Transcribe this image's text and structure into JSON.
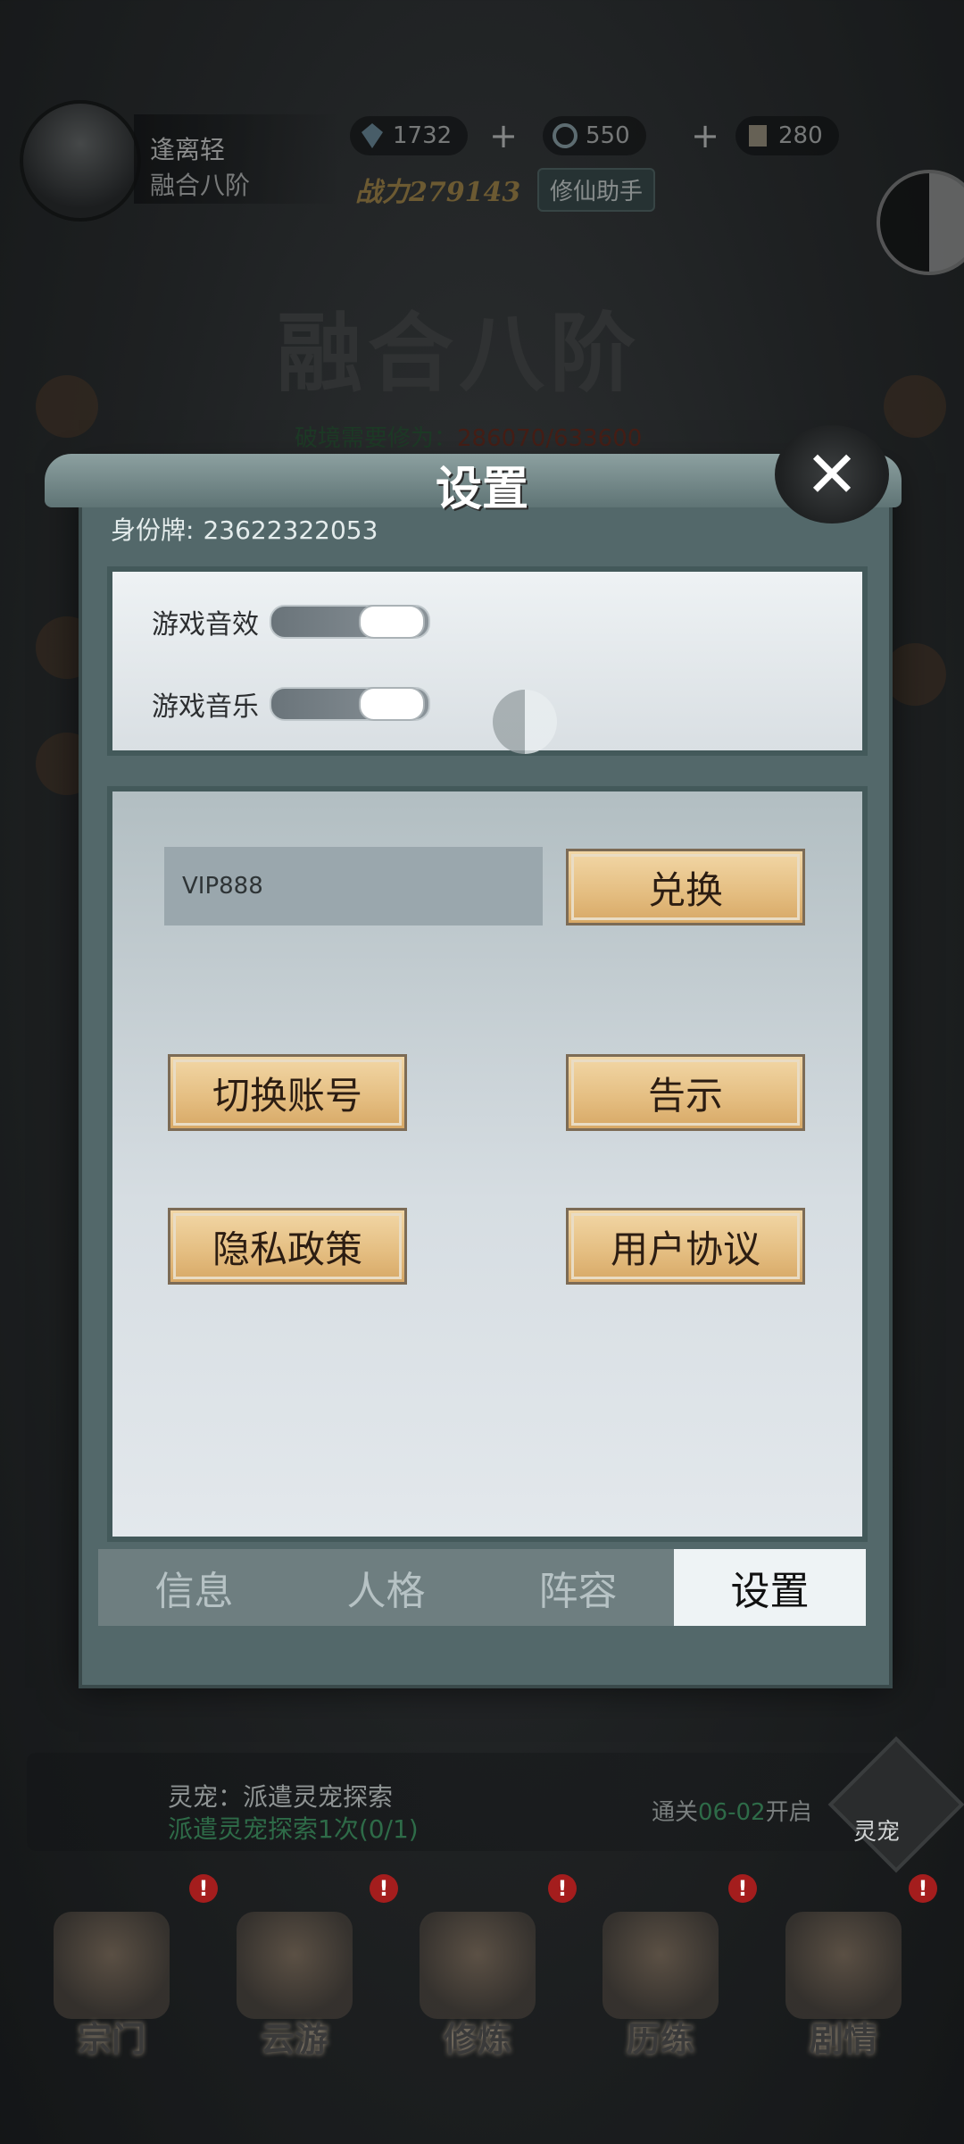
{
  "hud": {
    "player_name": "逢离轻",
    "realm": "融合八阶",
    "resources": [
      {
        "icon": "crystal-icon",
        "value": "1732"
      },
      {
        "icon": "spirit-coin-icon",
        "value": "550"
      },
      {
        "icon": "scroll-icon",
        "value": "280"
      }
    ],
    "power_label": "战力",
    "power_value": "279143",
    "assistant_label": "修仙助手"
  },
  "background": {
    "realm_title": "融合八阶",
    "breakthrough_label": "破境需要修为：",
    "breakthrough_value": "286070/633600"
  },
  "dialog": {
    "title": "设置",
    "close_icon": "close-icon",
    "id_label": "身份牌:",
    "id_value": "23622322053",
    "toggles": [
      {
        "label": "游戏音效",
        "state": "on"
      },
      {
        "label": "游戏音乐",
        "state": "on"
      }
    ],
    "redeem": {
      "input_value": "VIP888",
      "button_label": "兑换"
    },
    "buttons": {
      "switch_account": "切换账号",
      "notice": "告示",
      "privacy": "隐私政策",
      "user_agreement": "用户协议"
    },
    "tabs": [
      {
        "label": "信息",
        "active": false
      },
      {
        "label": "人格",
        "active": false
      },
      {
        "label": "阵容",
        "active": false
      },
      {
        "label": "设置",
        "active": true
      }
    ]
  },
  "pet_banner": {
    "line1": "灵宠：派遣灵宠探索",
    "line2": "派遣灵宠探索1次(0/1)",
    "unlock_prefix": "通关",
    "unlock_stage": "06-02",
    "unlock_suffix": "开启",
    "icon_label": "灵宠"
  },
  "navbar": [
    {
      "label": "宗门",
      "badge": "!"
    },
    {
      "label": "云游",
      "badge": "!"
    },
    {
      "label": "修炼",
      "badge": "!"
    },
    {
      "label": "历练",
      "badge": "!"
    },
    {
      "label": "剧情",
      "badge": "!"
    }
  ],
  "colors": {
    "accent_gold": "#e4bd80",
    "dialog_bg": "#53686a",
    "active_tab": "#eef3f5",
    "badge_red": "#a41d1d"
  }
}
